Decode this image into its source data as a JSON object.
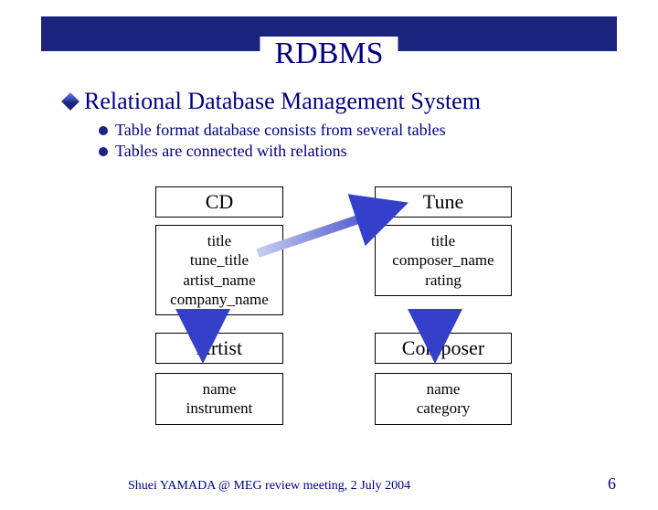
{
  "slide": {
    "title": "RDBMS",
    "bullet1": "Relational Database Management System",
    "sub1": "Table format database consists from several tables",
    "sub2": "Tables are connected with relations"
  },
  "entities": {
    "cd": {
      "title": "CD",
      "f1": "title",
      "f2": "tune_title",
      "f3": "artist_name",
      "f4": "company_name"
    },
    "tune": {
      "title": "Tune",
      "f1": "title",
      "f2": "composer_name",
      "f3": "rating"
    },
    "artist": {
      "title": "Artist",
      "f1": "name",
      "f2": "instrument"
    },
    "composer": {
      "title": "Composer",
      "f1": "name",
      "f2": "category"
    }
  },
  "footer": {
    "left": "Shuei YAMADA @ MEG review meeting, 2 July 2004",
    "page": "6"
  },
  "colors": {
    "navy": "#1a237e",
    "textnavy": "#000080",
    "arrow": "#3440c9"
  }
}
